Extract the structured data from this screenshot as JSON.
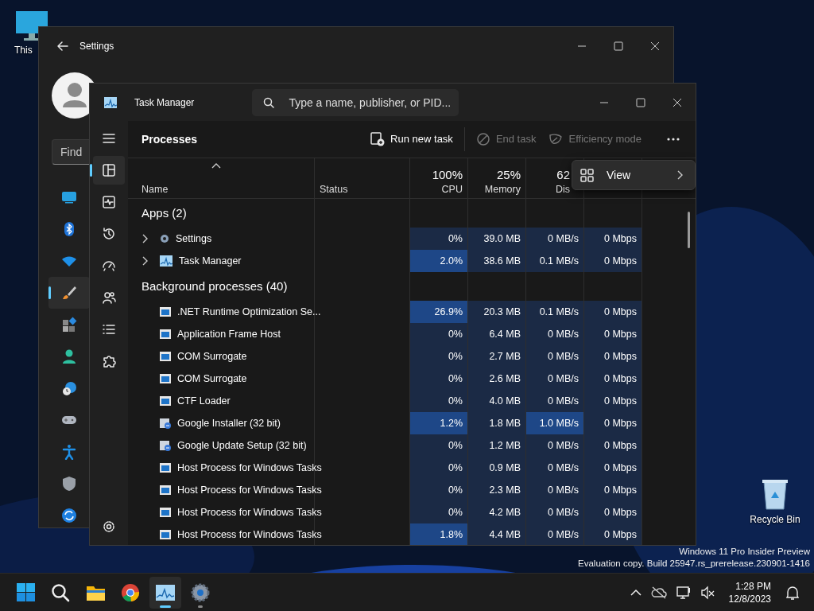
{
  "desktop_icons": [
    {
      "label": "This",
      "kind": "pc"
    },
    {
      "label": "Recycle Bin",
      "kind": "bin"
    }
  ],
  "settings": {
    "title": "Settings",
    "search": {
      "placeholder": "Find"
    },
    "nav": [
      {
        "kind": "system",
        "selected": false
      },
      {
        "kind": "bluetooth",
        "selected": false
      },
      {
        "kind": "wifi",
        "selected": false
      },
      {
        "kind": "brush",
        "selected": true
      },
      {
        "kind": "apps",
        "selected": false
      },
      {
        "kind": "account",
        "selected": false
      },
      {
        "kind": "time",
        "selected": false
      },
      {
        "kind": "gaming",
        "selected": false
      },
      {
        "kind": "accessibility",
        "selected": false
      },
      {
        "kind": "shield",
        "selected": false
      },
      {
        "kind": "update",
        "selected": false
      }
    ]
  },
  "task_manager": {
    "title": "Task Manager",
    "search": {
      "placeholder": "Type a name, publisher, or PID..."
    },
    "rail": [
      {
        "kind": "processes",
        "selected": true
      },
      {
        "kind": "performance",
        "selected": false
      },
      {
        "kind": "history",
        "selected": false
      },
      {
        "kind": "startup",
        "selected": false
      },
      {
        "kind": "users",
        "selected": false
      },
      {
        "kind": "details",
        "selected": false
      },
      {
        "kind": "services",
        "selected": false
      }
    ],
    "page_title": "Processes",
    "actions": [
      {
        "label": "Run new task",
        "kind": "run",
        "disabled": false
      },
      {
        "label": "End task",
        "kind": "end",
        "disabled": true
      },
      {
        "label": "Efficiency mode",
        "kind": "leaf",
        "disabled": true
      }
    ],
    "columns": [
      {
        "label": "Name",
        "sorted": true
      },
      {
        "label": "Status",
        "sorted": false
      },
      {
        "label": "CPU",
        "usage": "100%",
        "sorted": false
      },
      {
        "label": "Memory",
        "usage": "25%",
        "sorted": false
      },
      {
        "label": "Dis",
        "usage": "62",
        "sorted": false
      }
    ],
    "groups": [
      {
        "label": "Apps (2)",
        "rows": [
          {
            "name": "Settings",
            "kind": "gear",
            "expandable": true,
            "cpu": "0%",
            "memory": "39.0 MB",
            "disk": "0 MB/s",
            "network": "0 Mbps",
            "cpu_hot": false,
            "disk_hot": false
          },
          {
            "name": "Task Manager",
            "kind": "taskmgr",
            "expandable": true,
            "cpu": "2.0%",
            "memory": "38.6 MB",
            "disk": "0.1 MB/s",
            "network": "0 Mbps",
            "cpu_hot": true,
            "disk_hot": false
          }
        ]
      },
      {
        "label": "Background processes (40)",
        "rows": [
          {
            "name": ".NET Runtime Optimization Se...",
            "kind": "app",
            "expandable": false,
            "cpu": "26.9%",
            "memory": "20.3 MB",
            "disk": "0.1 MB/s",
            "network": "0 Mbps",
            "cpu_hot": true,
            "disk_hot": false
          },
          {
            "name": "Application Frame Host",
            "kind": "app",
            "expandable": false,
            "cpu": "0%",
            "memory": "6.4 MB",
            "disk": "0 MB/s",
            "network": "0 Mbps",
            "cpu_hot": false,
            "disk_hot": false
          },
          {
            "name": "COM Surrogate",
            "kind": "app",
            "expandable": false,
            "cpu": "0%",
            "memory": "2.7 MB",
            "disk": "0 MB/s",
            "network": "0 Mbps",
            "cpu_hot": false,
            "disk_hot": false
          },
          {
            "name": "COM Surrogate",
            "kind": "app",
            "expandable": false,
            "cpu": "0%",
            "memory": "2.6 MB",
            "disk": "0 MB/s",
            "network": "0 Mbps",
            "cpu_hot": false,
            "disk_hot": false
          },
          {
            "name": "CTF Loader",
            "kind": "app",
            "expandable": false,
            "cpu": "0%",
            "memory": "4.0 MB",
            "disk": "0 MB/s",
            "network": "0 Mbps",
            "cpu_hot": false,
            "disk_hot": false
          },
          {
            "name": "Google Installer (32 bit)",
            "kind": "installer",
            "expandable": false,
            "cpu": "1.2%",
            "memory": "1.8 MB",
            "disk": "1.0 MB/s",
            "network": "0 Mbps",
            "cpu_hot": true,
            "disk_hot": true
          },
          {
            "name": "Google Update Setup (32 bit)",
            "kind": "installer",
            "expandable": false,
            "cpu": "0%",
            "memory": "1.2 MB",
            "disk": "0 MB/s",
            "network": "0 Mbps",
            "cpu_hot": false,
            "disk_hot": false
          },
          {
            "name": "Host Process for Windows Tasks",
            "kind": "app",
            "expandable": false,
            "cpu": "0%",
            "memory": "0.9 MB",
            "disk": "0 MB/s",
            "network": "0 Mbps",
            "cpu_hot": false,
            "disk_hot": false
          },
          {
            "name": "Host Process for Windows Tasks",
            "kind": "app",
            "expandable": false,
            "cpu": "0%",
            "memory": "2.3 MB",
            "disk": "0 MB/s",
            "network": "0 Mbps",
            "cpu_hot": false,
            "disk_hot": false
          },
          {
            "name": "Host Process for Windows Tasks",
            "kind": "app",
            "expandable": false,
            "cpu": "0%",
            "memory": "4.2 MB",
            "disk": "0 MB/s",
            "network": "0 Mbps",
            "cpu_hot": false,
            "disk_hot": false
          },
          {
            "name": "Host Process for Windows Tasks",
            "kind": "app",
            "expandable": false,
            "cpu": "1.8%",
            "memory": "4.4 MB",
            "disk": "0 MB/s",
            "network": "0 Mbps",
            "cpu_hot": true,
            "disk_hot": false
          }
        ]
      }
    ],
    "menu": [
      {
        "label": "View",
        "kind": "grid"
      }
    ]
  },
  "build_info": [
    "Windows 11 Pro Insider Preview",
    "Evaluation copy. Build 25947.rs_prerelease.230901-1416"
  ],
  "taskbar": {
    "apps": [
      {
        "kind": "start",
        "active": false,
        "running": false
      },
      {
        "kind": "search",
        "active": false,
        "running": false
      },
      {
        "kind": "folder",
        "active": false,
        "running": false
      },
      {
        "kind": "chrome",
        "active": false,
        "running": false
      },
      {
        "kind": "taskmgr",
        "active": true,
        "running": true
      },
      {
        "kind": "settings",
        "active": false,
        "running": true
      }
    ],
    "time": "1:28 PM",
    "date": "12/8/2023"
  }
}
